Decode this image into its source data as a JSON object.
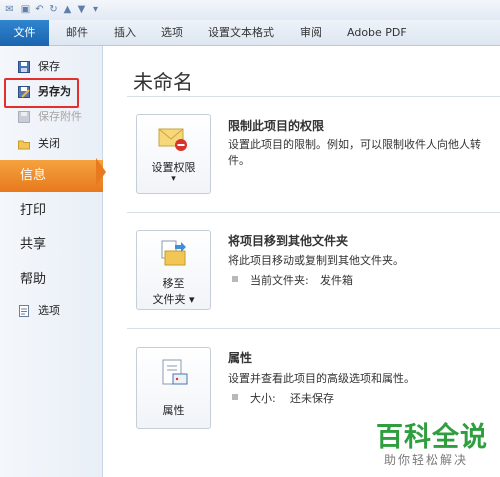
{
  "ribbon": {
    "file_tab": "文件",
    "tabs": [
      "邮件",
      "插入",
      "选项",
      "设置文本格式",
      "审阅",
      "Adobe PDF"
    ]
  },
  "nav": {
    "save": "保存",
    "save_as": "另存为",
    "save_attachment": "保存附件",
    "close": "关闭",
    "info": "信息",
    "print": "打印",
    "share": "共享",
    "help": "帮助",
    "options": "选项"
  },
  "main": {
    "title": "未命名",
    "permissions": {
      "button_line1": "设置权限",
      "button_arrow": "▾",
      "heading": "限制此项目的权限",
      "desc_line1": "设置此项目的限制。例如，可以限制收件人向他人转",
      "desc_line2": "件。"
    },
    "move": {
      "button_line1": "移至",
      "button_line2": "文件夹 ▾",
      "heading": "将项目移到其他文件夹",
      "desc": "将此项目移动或复制到其他文件夹。",
      "current_label": "当前文件夹:",
      "current_value": "发件箱"
    },
    "properties": {
      "button_label": "属性",
      "heading": "属性",
      "desc": "设置并查看此项目的高级选项和属性。",
      "size_label": "大小:",
      "size_value": "还未保存"
    }
  },
  "watermark": {
    "title": "百科全说",
    "subtitle": "助你轻松解决"
  },
  "colors": {
    "file_tab": "#1b63ae",
    "active_nav": "#e8791c",
    "highlight": "#e3302d",
    "brand": "#2f9e3f"
  }
}
